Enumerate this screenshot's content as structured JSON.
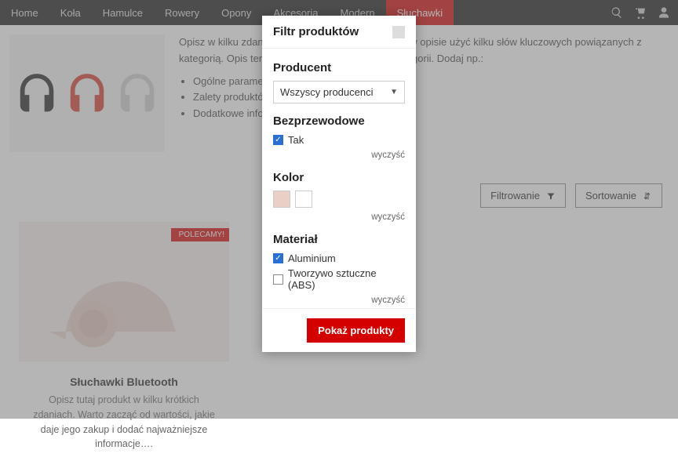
{
  "nav": {
    "items": [
      "Home",
      "Koła",
      "Hamulce",
      "Rowery",
      "Opony",
      "Akcesoria",
      "Modern",
      "Słuchawki"
    ],
    "activeIndex": 7
  },
  "category": {
    "desc_line1": "Opisz w kilku zdaniach powyższą kategorię. Warto w opisie użyć kilku słów kluczowych powiązanych z kategorią. Opis ten będzie widoczny na stronie kategorii. Dodaj np.:",
    "bullets": [
      "Ogólne parametry",
      "Zalety produktów",
      "Dodatkowe informacje"
    ]
  },
  "actions": {
    "filter": "Filtrowanie",
    "sort": "Sortowanie"
  },
  "product": {
    "ribbon": "POLECAMY!",
    "title": "Słuchawki Bluetooth",
    "desc": "Opisz tutaj produkt w kilku krótkich zdaniach. Warto zacząć od wartości, jakie daje jego zakup i dodać najważniejsze informacje…."
  },
  "modal": {
    "title": "Filtr produktów",
    "producer": {
      "label": "Producent",
      "selected": "Wszyscy producenci"
    },
    "wireless": {
      "label": "Bezprzewodowe",
      "option_yes": "Tak",
      "clear": "wyczyść"
    },
    "color": {
      "label": "Kolor",
      "swatches": [
        "#e9cfc6",
        "#ffffff"
      ],
      "clear": "wyczyść"
    },
    "material": {
      "label": "Materiał",
      "options": [
        "Aluminium",
        "Tworzywo sztuczne (ABS)"
      ],
      "checked": [
        true,
        false
      ],
      "clear": "wyczyść"
    },
    "apply": "Pokaż produkty"
  }
}
